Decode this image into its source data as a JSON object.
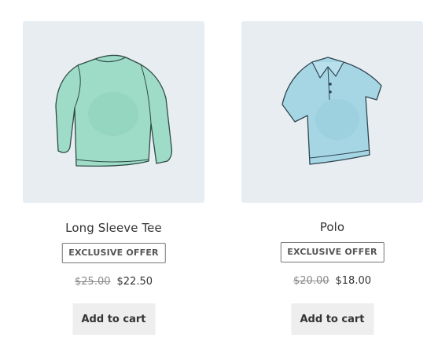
{
  "products": [
    {
      "name": "Long Sleeve Tee",
      "badge": "EXCLUSIVE OFFER",
      "regular_price": "$25.00",
      "sale_price": "$22.50",
      "button_label": "Add to cart",
      "image_icon": "long-sleeve-tee-icon",
      "image_color": "#9fdcc8"
    },
    {
      "name": "Polo",
      "badge": "EXCLUSIVE OFFER",
      "regular_price": "$20.00",
      "sale_price": "$18.00",
      "button_label": "Add to cart",
      "image_icon": "polo-shirt-icon",
      "image_color": "#a6d6e4"
    }
  ],
  "colors": {
    "thumbnail_bg": "#e8edf1",
    "button_bg": "#eeeeee",
    "text": "#333333"
  }
}
